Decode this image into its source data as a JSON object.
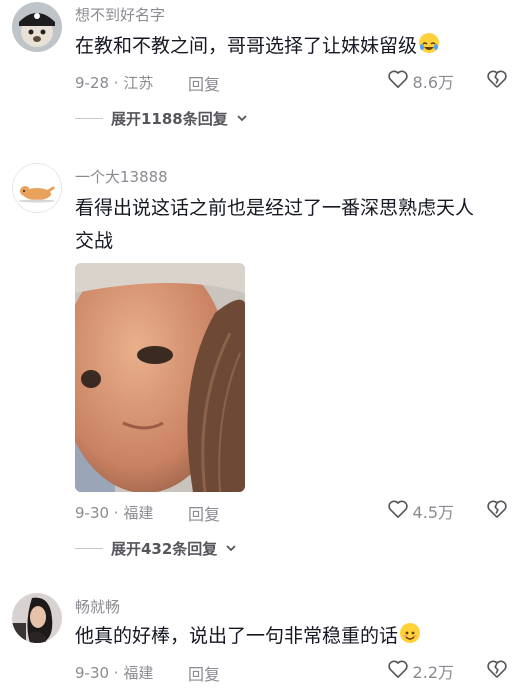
{
  "comments": [
    {
      "username": "想不到好名字",
      "text": "在教和不教之间，哥哥选择了让妹妹留级",
      "date_location": "9-28 · 江苏",
      "reply_label": "回复",
      "likes": "8.6万",
      "expand_label": "展开1188条回复",
      "emoji_icon": "crying-laughing-emoji-icon"
    },
    {
      "username": "一个大13888",
      "text_line1": "看得出说这话之前也是经过了一番深思熟虑天人",
      "text_line2": "交战",
      "date_location": "9-30 · 福建",
      "reply_label": "回复",
      "likes": "4.5万",
      "expand_label": "展开432条回复"
    },
    {
      "username": "畅就畅",
      "text": "他真的好棒，说出了一句非常稳重的话",
      "date_location": "9-30 · 福建",
      "reply_label": "回复",
      "likes": "2.2万",
      "emoji_icon": "smiling-emoji-icon"
    }
  ],
  "colors": {
    "text": "#161823",
    "muted": "#8a8b91"
  }
}
